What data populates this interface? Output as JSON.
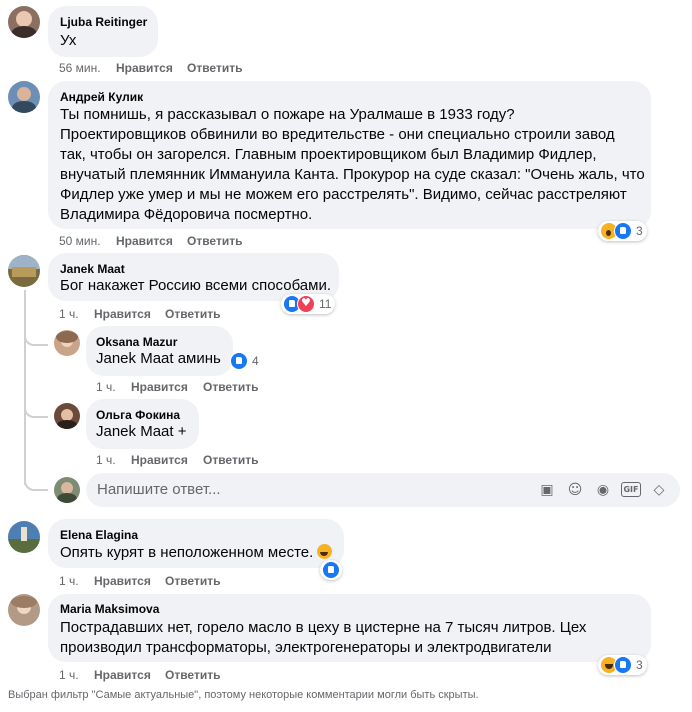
{
  "comments": [
    {
      "name": "Ljuba Reitinger",
      "lines": [
        "Ух"
      ],
      "time": "56 мин.",
      "like": "Нравится",
      "reply": "Ответить",
      "avatar_color": "#8b6f63"
    },
    {
      "name": "Андрей Кулик",
      "lines": [
        "Ты помнишь, я рассказывал о пожаре на Уралмаше в 1933 году?",
        "Проектировщиков обвинили во вредительстве - они специально строили завод",
        "так, чтобы он загорелся. Главным проектировщиком был Владимир Фидлер,",
        "внучатый племянник Иммануила Канта. Прокурор на суде сказал: \"Очень жаль, что",
        "Фидлер уже умер и мы не можем его расстрелять\". Видимо, сейчас расстреляют",
        "Владимира Фёдоровича посмертно."
      ],
      "time": "50 мин.",
      "like": "Нравится",
      "reply": "Ответить",
      "reactions": [
        "wow",
        "like"
      ],
      "reaction_count": "3",
      "avatar_color": "#6d8fb5"
    },
    {
      "name": "Janek Maat",
      "lines": [
        "Бог накажет Россию всеми способами."
      ],
      "time": "1 ч.",
      "like": "Нравится",
      "reply": "Ответить",
      "reactions": [
        "like",
        "love"
      ],
      "reaction_count": "11",
      "avatar_color": "#7a6a3f"
    },
    {
      "name": "Elena Elagina",
      "lines": [
        "Опять курят в неположенном месте."
      ],
      "time": "1 ч.",
      "like": "Нравится",
      "reply": "Ответить",
      "reactions": [
        "like"
      ],
      "reaction_count": "",
      "avatar_color": "#4e7fb3"
    },
    {
      "name": "Maria Maksimova",
      "lines": [
        "Пострадавших нет, горело масло в цеху в цистерне на 7 тысяч литров. Цех",
        "производил трансформаторы, электрогенераторы и электродвигатели"
      ],
      "time": "1 ч.",
      "like": "Нравится",
      "reply": "Ответить",
      "reactions": [
        "haha",
        "like"
      ],
      "reaction_count": "3",
      "avatar_color": "#b39a86"
    }
  ],
  "replies": [
    {
      "name": "Oksana Mazur",
      "mention": "Janek Maat",
      "text": "аминь",
      "time": "1 ч.",
      "like": "Нравится",
      "reply": "Ответить",
      "reactions": [
        "like"
      ],
      "reaction_count": "4",
      "avatar_color": "#c9a48a"
    },
    {
      "name": "Ольга Фокина",
      "mention": "Janek Maat",
      "text": "+",
      "time": "1 ч.",
      "like": "Нравится",
      "reply": "Ответить",
      "avatar_color": "#6b4a3a"
    }
  ],
  "reply_input": {
    "placeholder": "Напишите ответ...",
    "tools": [
      "sticker-icon",
      "emoji-icon",
      "camera-icon",
      "gif-icon",
      "sticker-pack-icon"
    ],
    "gif_label": "GIF"
  },
  "footer_note": "Выбран фильтр \"Самые актуальные\", поэтому некоторые комментарии могли быть скрыты.",
  "colors": {
    "bubble": "#f0f2f5",
    "meta": "#65676b",
    "like": "#1877f2",
    "love": "#f33e58",
    "haha": "#f7b125"
  }
}
